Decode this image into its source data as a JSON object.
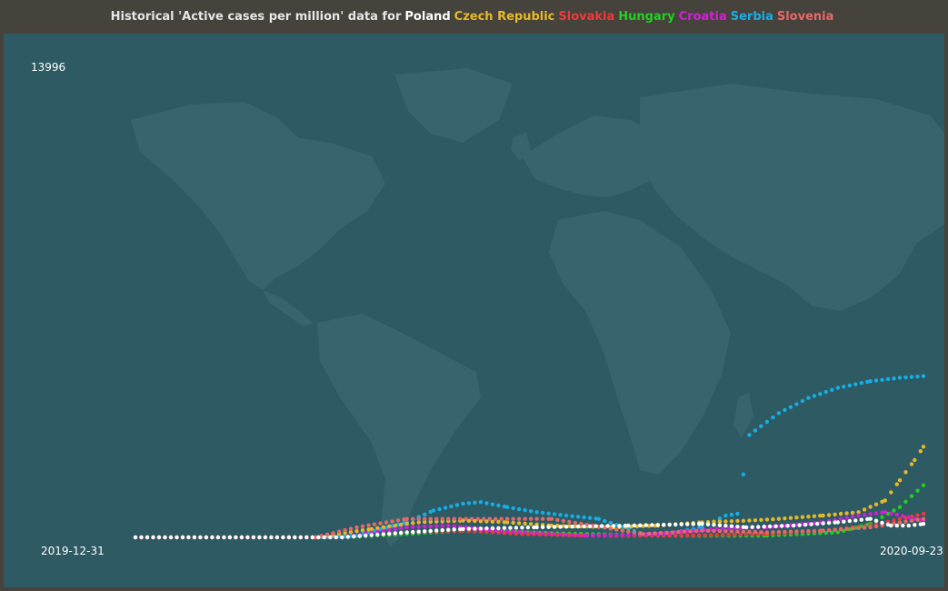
{
  "title": {
    "prefix": "Historical 'Active cases per million' data for",
    "countries": [
      {
        "name": "Poland",
        "color": "#ffffff"
      },
      {
        "name": "Czech Republic",
        "color": "#e7b92a"
      },
      {
        "name": "Slovakia",
        "color": "#ef3a3a"
      },
      {
        "name": "Hungary",
        "color": "#21d021"
      },
      {
        "name": "Croatia",
        "color": "#d21fd8"
      },
      {
        "name": "Serbia",
        "color": "#16aee6"
      },
      {
        "name": "Slovenia",
        "color": "#e46a6a"
      }
    ]
  },
  "colors": {
    "background": "#46423c",
    "plot_background": "#2e5a63",
    "land": "#3f6b74"
  },
  "chart_data": {
    "type": "scatter",
    "y_max_label": "13996",
    "x_start_label": "2019-12-31",
    "x_end_label": "2020-09-23",
    "x_start": "2019-12-31",
    "x_end": "2020-09-23",
    "ylim": [
      0,
      13996
    ],
    "legend_position": "title",
    "grid": false,
    "background_map": "world-map",
    "series": [
      {
        "name": "Serbia",
        "color": "#16aee6",
        "points": [
          [
            "2019-12-31",
            0
          ],
          [
            "2020-03-01",
            0
          ],
          [
            "2020-03-15",
            50
          ],
          [
            "2020-04-01",
            450
          ],
          [
            "2020-04-10",
            800
          ],
          [
            "2020-04-20",
            1000
          ],
          [
            "2020-04-26",
            1050
          ],
          [
            "2020-05-05",
            900
          ],
          [
            "2020-05-15",
            750
          ],
          [
            "2020-05-25",
            650
          ],
          [
            "2020-06-05",
            550
          ],
          [
            "2020-06-20",
            100
          ],
          [
            "2020-07-01",
            150
          ],
          [
            "2020-07-10",
            300
          ],
          [
            "2020-07-18",
            650
          ],
          [
            "2020-07-22",
            700
          ],
          [
            "2020-07-26",
            3050
          ],
          [
            "2020-08-05",
            3700
          ],
          [
            "2020-08-15",
            4150
          ],
          [
            "2020-08-25",
            4450
          ],
          [
            "2020-09-05",
            4650
          ],
          [
            "2020-09-15",
            4750
          ],
          [
            "2020-09-23",
            4800
          ]
        ]
      },
      {
        "name": "Czech Republic",
        "color": "#e7b92a",
        "points": [
          [
            "2019-12-31",
            0
          ],
          [
            "2020-03-01",
            0
          ],
          [
            "2020-03-20",
            250
          ],
          [
            "2020-04-05",
            450
          ],
          [
            "2020-04-20",
            500
          ],
          [
            "2020-05-05",
            450
          ],
          [
            "2020-05-20",
            350
          ],
          [
            "2020-06-10",
            300
          ],
          [
            "2020-06-25",
            350
          ],
          [
            "2020-07-10",
            450
          ],
          [
            "2020-07-26",
            500
          ],
          [
            "2020-08-05",
            550
          ],
          [
            "2020-08-20",
            650
          ],
          [
            "2020-09-01",
            750
          ],
          [
            "2020-09-10",
            1100
          ],
          [
            "2020-09-15",
            1700
          ],
          [
            "2020-09-20",
            2300
          ],
          [
            "2020-09-23",
            2700
          ]
        ]
      },
      {
        "name": "Hungary",
        "color": "#21d021",
        "points": [
          [
            "2019-12-31",
            0
          ],
          [
            "2020-03-10",
            0
          ],
          [
            "2020-04-01",
            100
          ],
          [
            "2020-04-20",
            200
          ],
          [
            "2020-05-10",
            150
          ],
          [
            "2020-06-01",
            100
          ],
          [
            "2020-07-01",
            50
          ],
          [
            "2020-08-01",
            50
          ],
          [
            "2020-08-25",
            150
          ],
          [
            "2020-09-05",
            400
          ],
          [
            "2020-09-15",
            900
          ],
          [
            "2020-09-23",
            1550
          ]
        ]
      },
      {
        "name": "Slovakia",
        "color": "#ef3a3a",
        "points": [
          [
            "2019-12-31",
            0
          ],
          [
            "2020-03-10",
            0
          ],
          [
            "2020-04-01",
            150
          ],
          [
            "2020-04-20",
            200
          ],
          [
            "2020-05-10",
            100
          ],
          [
            "2020-06-01",
            50
          ],
          [
            "2020-07-01",
            50
          ],
          [
            "2020-08-01",
            100
          ],
          [
            "2020-08-20",
            200
          ],
          [
            "2020-09-05",
            350
          ],
          [
            "2020-09-23",
            700
          ]
        ]
      },
      {
        "name": "Croatia",
        "color": "#d21fd8",
        "points": [
          [
            "2019-12-31",
            0
          ],
          [
            "2020-03-10",
            0
          ],
          [
            "2020-04-01",
            300
          ],
          [
            "2020-04-15",
            350
          ],
          [
            "2020-05-01",
            200
          ],
          [
            "2020-06-01",
            50
          ],
          [
            "2020-06-25",
            100
          ],
          [
            "2020-07-15",
            250
          ],
          [
            "2020-08-01",
            300
          ],
          [
            "2020-08-20",
            450
          ],
          [
            "2020-09-01",
            650
          ],
          [
            "2020-09-10",
            750
          ],
          [
            "2020-09-23",
            500
          ]
        ]
      },
      {
        "name": "Slovenia",
        "color": "#e46a6a",
        "points": [
          [
            "2019-12-31",
            0
          ],
          [
            "2020-03-01",
            0
          ],
          [
            "2020-03-15",
            300
          ],
          [
            "2020-04-01",
            550
          ],
          [
            "2020-04-15",
            550
          ],
          [
            "2020-05-01",
            550
          ],
          [
            "2020-05-20",
            550
          ],
          [
            "2020-06-20",
            100
          ],
          [
            "2020-07-10",
            200
          ],
          [
            "2020-08-01",
            150
          ],
          [
            "2020-08-20",
            200
          ],
          [
            "2020-09-05",
            300
          ],
          [
            "2020-09-23",
            550
          ]
        ]
      },
      {
        "name": "Poland",
        "color": "#ffffff",
        "points": [
          [
            "2019-12-31",
            0
          ],
          [
            "2020-03-10",
            0
          ],
          [
            "2020-04-01",
            150
          ],
          [
            "2020-04-20",
            250
          ],
          [
            "2020-05-15",
            300
          ],
          [
            "2020-06-15",
            350
          ],
          [
            "2020-07-10",
            400
          ],
          [
            "2020-07-25",
            300
          ],
          [
            "2020-08-10",
            350
          ],
          [
            "2020-08-25",
            450
          ],
          [
            "2020-09-05",
            550
          ],
          [
            "2020-09-12",
            350
          ],
          [
            "2020-09-18",
            350
          ],
          [
            "2020-09-23",
            400
          ]
        ]
      }
    ]
  }
}
